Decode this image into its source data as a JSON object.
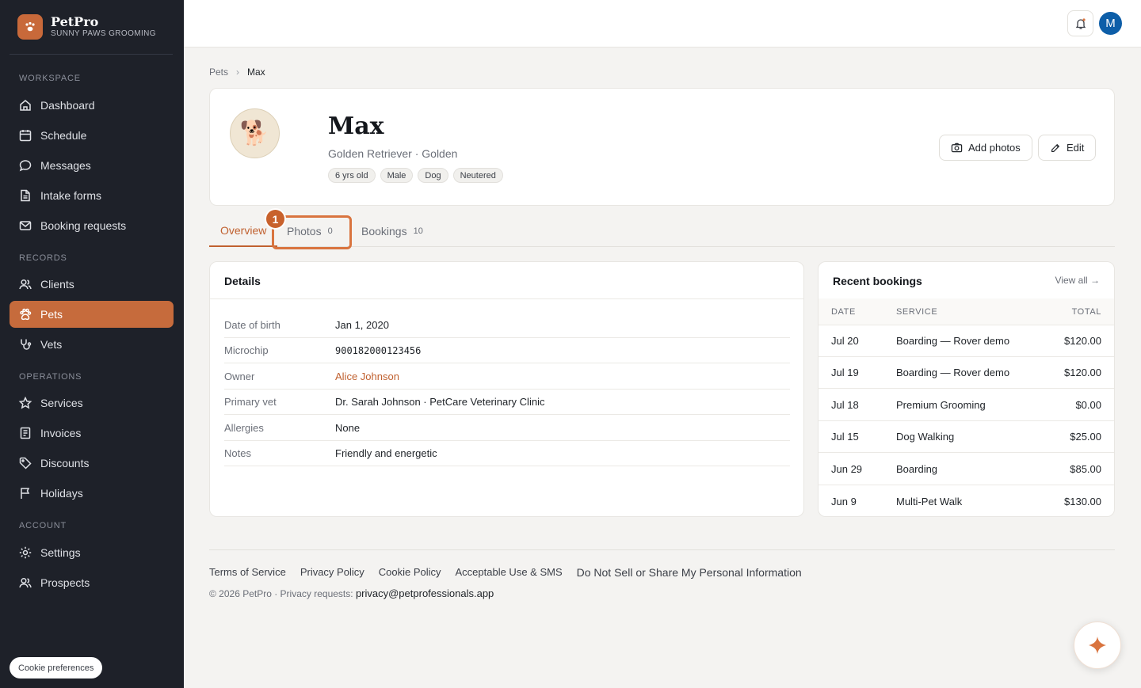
{
  "brand": {
    "name": "PetPro",
    "subtitle": "SUNNY PAWS GROOMING",
    "logo_icon": "paw-icon",
    "accent": "#c66b3c"
  },
  "sidebar": {
    "sections": [
      {
        "label": "WORKSPACE"
      },
      {
        "label": "RECORDS"
      },
      {
        "label": "OPERATIONS"
      },
      {
        "label": "ACCOUNT"
      }
    ],
    "items": [
      {
        "label": "Dashboard",
        "icon": "home-icon"
      },
      {
        "label": "Schedule",
        "icon": "calendar-icon"
      },
      {
        "label": "Messages",
        "icon": "chat-icon"
      },
      {
        "label": "Intake forms",
        "icon": "document-icon"
      },
      {
        "label": "Booking requests",
        "icon": "mail-icon"
      },
      {
        "label": "Clients",
        "icon": "users-icon"
      },
      {
        "label": "Pets",
        "icon": "paw-icon",
        "active": true
      },
      {
        "label": "Vets",
        "icon": "stethoscope-icon"
      },
      {
        "label": "Services",
        "icon": "star-icon"
      },
      {
        "label": "Invoices",
        "icon": "receipt-icon"
      },
      {
        "label": "Discounts",
        "icon": "tag-icon"
      },
      {
        "label": "Holidays",
        "icon": "flag-icon"
      },
      {
        "label": "Settings",
        "icon": "gear-icon"
      },
      {
        "label": "Prospects",
        "icon": "users-icon"
      }
    ],
    "cookie_label": "Cookie preferences"
  },
  "topbar": {
    "avatar_initial": "M"
  },
  "breadcrumb": {
    "parent": "Pets",
    "current": "Max"
  },
  "pet": {
    "name": "Max",
    "breed": "Golden Retriever · Golden",
    "avatar_emoji": "🐕",
    "tags": [
      "6 yrs old",
      "Male",
      "Dog",
      "Neutered"
    ],
    "add_photos_label": "Add photos",
    "edit_label": "Edit"
  },
  "tabs": [
    {
      "label": "Overview",
      "count": ""
    },
    {
      "label": "Photos",
      "count": "0"
    },
    {
      "label": "Bookings",
      "count": "10"
    }
  ],
  "marker": {
    "number": "1"
  },
  "details": {
    "title": "Details",
    "rows": [
      {
        "label": "Date of birth",
        "value": "Jan 1, 2020"
      },
      {
        "label": "Microchip",
        "value": "900182000123456"
      },
      {
        "label": "Owner",
        "value": "Alice Johnson"
      },
      {
        "label": "Primary vet",
        "value": "Dr. Sarah Johnson · PetCare Veterinary Clinic"
      },
      {
        "label": "Allergies",
        "value": "None"
      },
      {
        "label": "Notes",
        "value": "Friendly and energetic"
      }
    ]
  },
  "bookings": {
    "title": "Recent bookings",
    "view_all": "View all →",
    "headers": {
      "date": "DATE",
      "service": "SERVICE",
      "total": "TOTAL"
    },
    "rows": [
      {
        "date": "Jul 20",
        "service": "Boarding — Rover demo",
        "total": "$120.00"
      },
      {
        "date": "Jul 19",
        "service": "Boarding — Rover demo",
        "total": "$120.00"
      },
      {
        "date": "Jul 18",
        "service": "Premium Grooming",
        "total": "$0.00"
      },
      {
        "date": "Jul 15",
        "service": "Dog Walking",
        "total": "$25.00"
      },
      {
        "date": "Jun 29",
        "service": "Boarding",
        "total": "$85.00"
      },
      {
        "date": "Jun 9",
        "service": "Multi-Pet Walk",
        "total": "$130.00"
      }
    ]
  },
  "footer": {
    "links": [
      "Terms of Service",
      "Privacy Policy",
      "Cookie Policy",
      "Acceptable Use & SMS",
      "Do Not Sell or Share My Personal Information"
    ],
    "copyright": "© 2026 PetPro · Privacy requests:",
    "email": "privacy@petprofessionals.app"
  }
}
